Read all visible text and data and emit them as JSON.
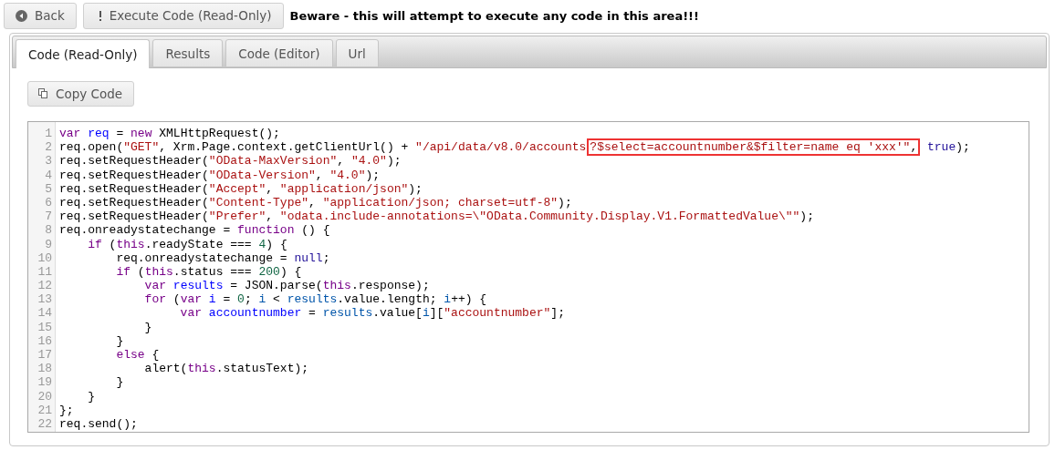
{
  "toolbar": {
    "back_button": "Back",
    "execute_button": "Execute Code (Read-Only)",
    "warning": "Beware - this will attempt to execute any code in this area!!!"
  },
  "tabs": [
    {
      "label": "Code (Read-Only)",
      "selected": true
    },
    {
      "label": "Results",
      "selected": false
    },
    {
      "label": "Code (Editor)",
      "selected": false
    },
    {
      "label": "Url",
      "selected": false
    }
  ],
  "copy_button": "Copy Code",
  "code": [
    {
      "number": "1",
      "tokens": [
        {
          "kind": "keyword",
          "text": "var"
        },
        {
          "kind": "def",
          "text": " req"
        },
        {
          "kind": "plain",
          "text": " = "
        },
        {
          "kind": "keyword",
          "text": "new"
        },
        {
          "kind": "plain",
          "text": " XMLHttpRequest();"
        }
      ]
    },
    {
      "number": "2",
      "tokens": [
        {
          "kind": "plain",
          "text": "req.open("
        },
        {
          "kind": "string",
          "text": "\"GET\""
        },
        {
          "kind": "plain",
          "text": ", Xrm.Page.context.getClientUrl() + "
        },
        {
          "kind": "string",
          "text": "\"/api/data/v8.0/accounts"
        },
        {
          "kind": "boxed",
          "children": [
            {
              "kind": "string",
              "text": "?$select=accountnumber&$filter=name eq 'xxx'\""
            },
            {
              "kind": "plain",
              "text": ","
            }
          ]
        },
        {
          "kind": "atom",
          "text": " true"
        },
        {
          "kind": "plain",
          "text": ");"
        }
      ]
    },
    {
      "number": "3",
      "tokens": [
        {
          "kind": "plain",
          "text": "req.setRequestHeader("
        },
        {
          "kind": "string",
          "text": "\"OData-MaxVersion\""
        },
        {
          "kind": "plain",
          "text": ", "
        },
        {
          "kind": "string",
          "text": "\"4.0\""
        },
        {
          "kind": "plain",
          "text": ");"
        }
      ]
    },
    {
      "number": "4",
      "tokens": [
        {
          "kind": "plain",
          "text": "req.setRequestHeader("
        },
        {
          "kind": "string",
          "text": "\"OData-Version\""
        },
        {
          "kind": "plain",
          "text": ", "
        },
        {
          "kind": "string",
          "text": "\"4.0\""
        },
        {
          "kind": "plain",
          "text": ");"
        }
      ]
    },
    {
      "number": "5",
      "tokens": [
        {
          "kind": "plain",
          "text": "req.setRequestHeader("
        },
        {
          "kind": "string",
          "text": "\"Accept\""
        },
        {
          "kind": "plain",
          "text": ", "
        },
        {
          "kind": "string",
          "text": "\"application/json\""
        },
        {
          "kind": "plain",
          "text": ");"
        }
      ]
    },
    {
      "number": "6",
      "tokens": [
        {
          "kind": "plain",
          "text": "req.setRequestHeader("
        },
        {
          "kind": "string",
          "text": "\"Content-Type\""
        },
        {
          "kind": "plain",
          "text": ", "
        },
        {
          "kind": "string",
          "text": "\"application/json; charset=utf-8\""
        },
        {
          "kind": "plain",
          "text": ");"
        }
      ]
    },
    {
      "number": "7",
      "tokens": [
        {
          "kind": "plain",
          "text": "req.setRequestHeader("
        },
        {
          "kind": "string",
          "text": "\"Prefer\""
        },
        {
          "kind": "plain",
          "text": ", "
        },
        {
          "kind": "string",
          "text": "\"odata.include-annotations=\\\"OData.Community.Display.V1.FormattedValue\\\"\""
        },
        {
          "kind": "plain",
          "text": ");"
        }
      ]
    },
    {
      "number": "8",
      "tokens": [
        {
          "kind": "plain",
          "text": "req.onreadystatechange = "
        },
        {
          "kind": "keyword",
          "text": "function"
        },
        {
          "kind": "plain",
          "text": " () {"
        }
      ]
    },
    {
      "number": "9",
      "tokens": [
        {
          "kind": "keyword",
          "text": "    if"
        },
        {
          "kind": "plain",
          "text": " ("
        },
        {
          "kind": "keyword",
          "text": "this"
        },
        {
          "kind": "plain",
          "text": ".readyState === "
        },
        {
          "kind": "number",
          "text": "4"
        },
        {
          "kind": "plain",
          "text": ") {"
        }
      ]
    },
    {
      "number": "10",
      "tokens": [
        {
          "kind": "plain",
          "text": "        req.onreadystatechange = "
        },
        {
          "kind": "atom",
          "text": "null"
        },
        {
          "kind": "plain",
          "text": ";"
        }
      ]
    },
    {
      "number": "11",
      "tokens": [
        {
          "kind": "keyword",
          "text": "        if"
        },
        {
          "kind": "plain",
          "text": " ("
        },
        {
          "kind": "keyword",
          "text": "this"
        },
        {
          "kind": "plain",
          "text": ".status === "
        },
        {
          "kind": "number",
          "text": "200"
        },
        {
          "kind": "plain",
          "text": ") {"
        }
      ]
    },
    {
      "number": "12",
      "tokens": [
        {
          "kind": "keyword",
          "text": "            var"
        },
        {
          "kind": "def",
          "text": " results"
        },
        {
          "kind": "plain",
          "text": " = JSON.parse("
        },
        {
          "kind": "keyword",
          "text": "this"
        },
        {
          "kind": "plain",
          "text": ".response);"
        }
      ]
    },
    {
      "number": "13",
      "tokens": [
        {
          "kind": "keyword",
          "text": "            for"
        },
        {
          "kind": "plain",
          "text": " ("
        },
        {
          "kind": "keyword",
          "text": "var"
        },
        {
          "kind": "def",
          "text": " i"
        },
        {
          "kind": "plain",
          "text": " = "
        },
        {
          "kind": "number",
          "text": "0"
        },
        {
          "kind": "plain",
          "text": "; "
        },
        {
          "kind": "variable",
          "text": "i"
        },
        {
          "kind": "plain",
          "text": " < "
        },
        {
          "kind": "variable",
          "text": "results"
        },
        {
          "kind": "plain",
          "text": ".value.length; "
        },
        {
          "kind": "variable",
          "text": "i"
        },
        {
          "kind": "plain",
          "text": "++) {"
        }
      ]
    },
    {
      "number": "14",
      "tokens": [
        {
          "kind": "keyword",
          "text": "                 var"
        },
        {
          "kind": "def",
          "text": " accountnumber"
        },
        {
          "kind": "plain",
          "text": " = "
        },
        {
          "kind": "variable",
          "text": "results"
        },
        {
          "kind": "plain",
          "text": ".value["
        },
        {
          "kind": "variable",
          "text": "i"
        },
        {
          "kind": "plain",
          "text": "]["
        },
        {
          "kind": "string",
          "text": "\"accountnumber\""
        },
        {
          "kind": "plain",
          "text": "];"
        }
      ]
    },
    {
      "number": "15",
      "tokens": [
        {
          "kind": "plain",
          "text": "            }"
        }
      ]
    },
    {
      "number": "16",
      "tokens": [
        {
          "kind": "plain",
          "text": "        }"
        }
      ]
    },
    {
      "number": "17",
      "tokens": [
        {
          "kind": "keyword",
          "text": "        else"
        },
        {
          "kind": "plain",
          "text": " {"
        }
      ]
    },
    {
      "number": "18",
      "tokens": [
        {
          "kind": "plain",
          "text": "            alert("
        },
        {
          "kind": "keyword",
          "text": "this"
        },
        {
          "kind": "plain",
          "text": ".statusText);"
        }
      ]
    },
    {
      "number": "19",
      "tokens": [
        {
          "kind": "plain",
          "text": "        }"
        }
      ]
    },
    {
      "number": "20",
      "tokens": [
        {
          "kind": "plain",
          "text": "    }"
        }
      ]
    },
    {
      "number": "21",
      "tokens": [
        {
          "kind": "plain",
          "text": "};"
        }
      ]
    },
    {
      "number": "22",
      "tokens": [
        {
          "kind": "plain",
          "text": "req.send();"
        }
      ]
    }
  ]
}
